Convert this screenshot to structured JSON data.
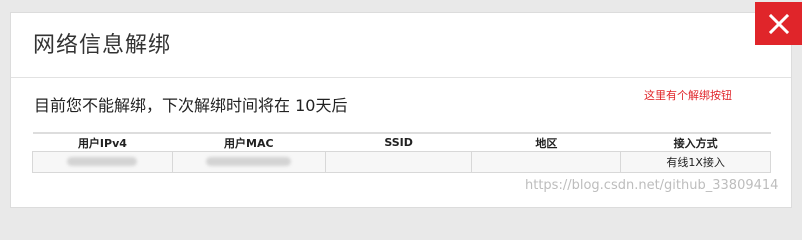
{
  "dialog": {
    "title": "网络信息解绑",
    "close_icon": "close-icon",
    "message": "目前您不能解绑，下次解绑时间将在 10天后",
    "annotation": "这里有个解绑按钮"
  },
  "table": {
    "headers": [
      "用户IPv4",
      "用户MAC",
      "SSID",
      "地区",
      "接入方式"
    ],
    "row": {
      "ipv4": "",
      "mac": "",
      "ssid": "",
      "region": "",
      "access": "有线1X接入"
    }
  },
  "watermark": "https://blog.csdn.net/github_33809414",
  "colors": {
    "close_bg": "#e0252a",
    "annotation": "#e0252a"
  }
}
